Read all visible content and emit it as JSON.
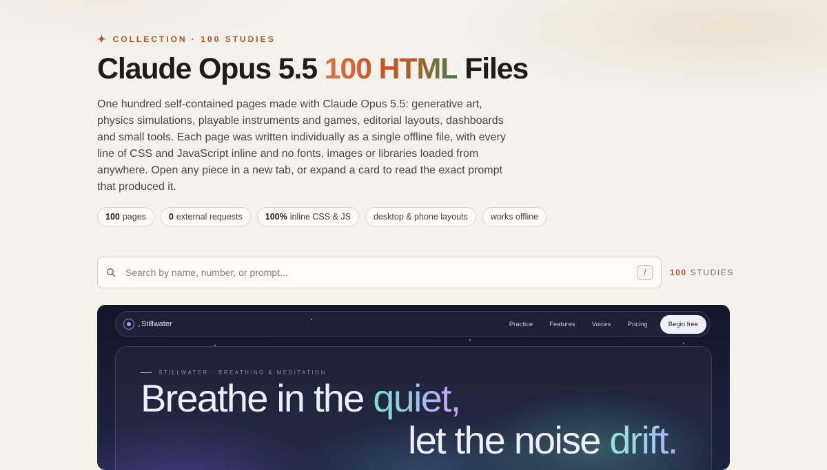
{
  "header": {
    "eyebrow": "COLLECTION · 100 STUDIES",
    "title_prefix": "Claude Opus 5.5 ",
    "title_accent": "100 HTML",
    "title_suffix": " Files",
    "description": "One hundred self-contained pages made with Claude Opus 5.5: generative art, physics simulations, playable instruments and games, editorial layouts, dashboards and small tools. Each page was written individually as a single offline file, with every line of CSS and JavaScript inline and no fonts, images or libraries loaded from anywhere. Open any piece in a new tab, or expand a card to read the exact prompt that produced it."
  },
  "chips": [
    {
      "bold": "100",
      "text": "pages"
    },
    {
      "bold": "0",
      "text": "external requests"
    },
    {
      "bold": "100%",
      "text": "inline CSS & JS"
    },
    {
      "bold": "",
      "text": "desktop & phone layouts"
    },
    {
      "bold": "",
      "text": "works offline"
    }
  ],
  "search": {
    "placeholder": "Search by name, number, or prompt...",
    "shortcut": "/",
    "count_number": "100",
    "count_label": "STUDIES"
  },
  "preview": {
    "brand": "Stillwater",
    "nav": [
      "Practice",
      "Features",
      "Voices",
      "Pricing"
    ],
    "cta": "Begin free",
    "kicker": "STILLWATER · BREATHING & MEDITATION",
    "line1_plain": "Breathe in the ",
    "line1_accent": "quiet,",
    "line2_plain": "let the noise ",
    "line2_accent": "drift."
  },
  "colors": {
    "accent": "#b4532c",
    "background": "#f5f2ec",
    "preview_bg": "#171d33"
  },
  "icons": [
    "sparkle-icon",
    "search-icon",
    "logo-ring-icon"
  ]
}
